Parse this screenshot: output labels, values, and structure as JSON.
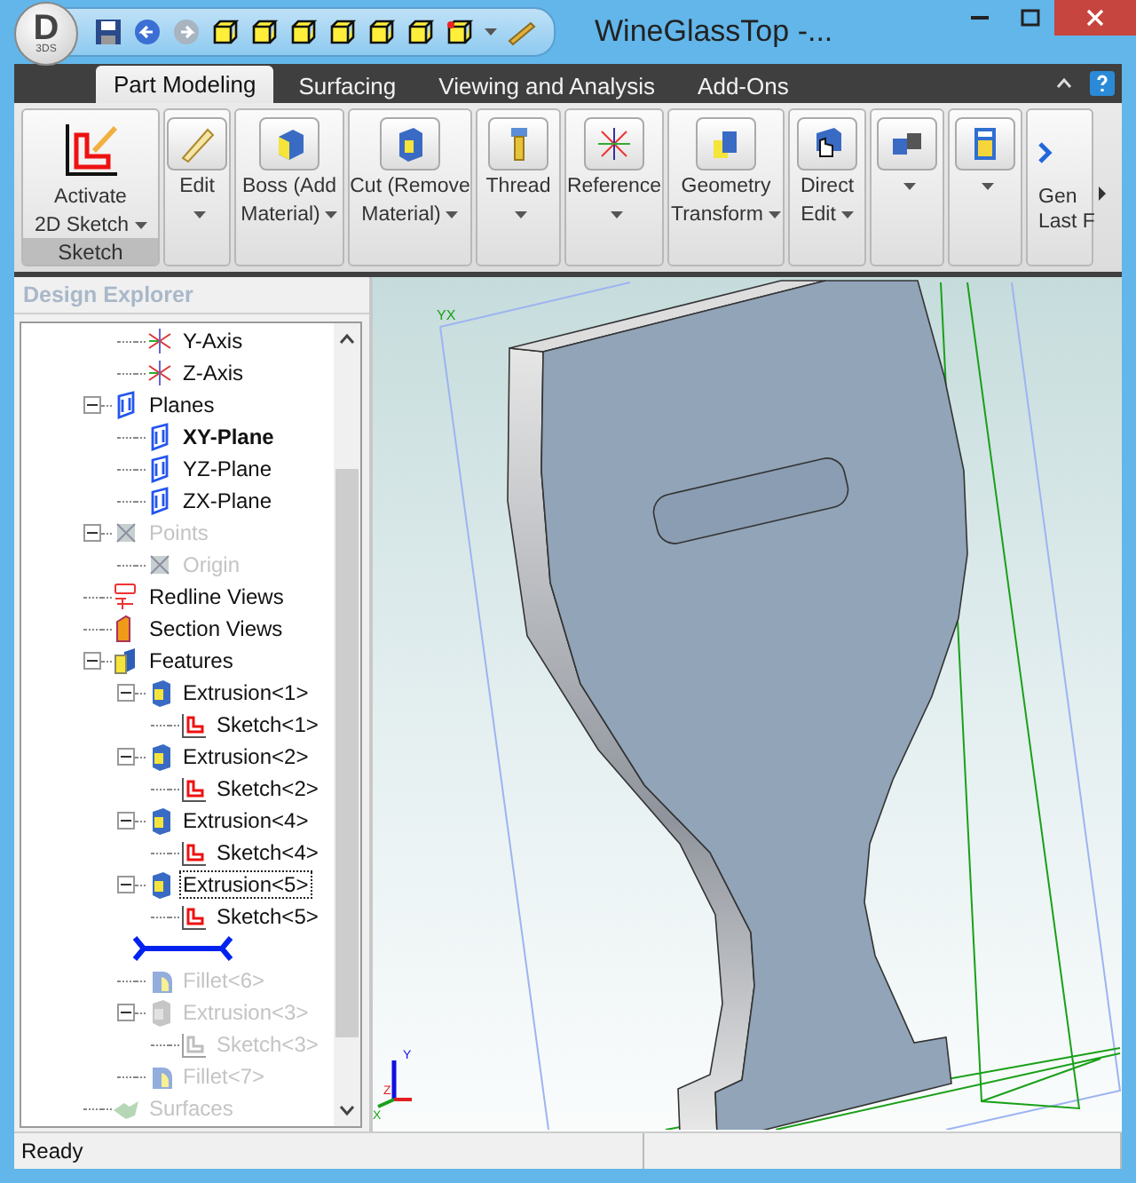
{
  "window": {
    "title": "WineGlassTop -...",
    "logo_letter": "D",
    "logo_sub": "3DS"
  },
  "quick_access": {
    "redo_disabled": true
  },
  "tabs": [
    {
      "label": "Part Modeling",
      "selected": true
    },
    {
      "label": "Surfacing",
      "selected": false
    },
    {
      "label": "Viewing and Analysis",
      "selected": false
    },
    {
      "label": "Add-Ons",
      "selected": false
    }
  ],
  "ribbon": {
    "buttons": [
      {
        "kind": "large",
        "lines": [
          "Activate",
          "2D Sketch"
        ],
        "dropdown": true,
        "group": "Sketch"
      },
      {
        "kind": "small",
        "lines": [
          "Edit"
        ],
        "dropdown": true
      },
      {
        "kind": "small",
        "lines": [
          "Boss (Add",
          "Material)"
        ],
        "dropdown": true
      },
      {
        "kind": "small",
        "lines": [
          "Cut (Remove",
          "Material)"
        ],
        "dropdown": true
      },
      {
        "kind": "small",
        "lines": [
          "Thread"
        ],
        "dropdown": true
      },
      {
        "kind": "small",
        "lines": [
          "Reference"
        ],
        "dropdown": true
      },
      {
        "kind": "small",
        "lines": [
          "Geometry",
          "Transform"
        ],
        "dropdown": true
      },
      {
        "kind": "small",
        "lines": [
          "Direct",
          "Edit"
        ],
        "dropdown": true
      },
      {
        "kind": "small",
        "dropdown": true
      },
      {
        "kind": "small",
        "dropdown": true
      },
      {
        "kind": "cut",
        "lines": [
          "Gen",
          "Last F"
        ],
        "dropdown": false
      }
    ]
  },
  "explorer": {
    "title": "Design Explorer",
    "tree": [
      {
        "children": [
          {
            "kind": "axis",
            "label": "Y-Axis",
            "active": false,
            "disabled": false,
            "selected": false
          },
          {
            "kind": "axis",
            "label": "Z-Axis",
            "active": false,
            "disabled": false,
            "selected": false
          }
        ]
      },
      {
        "kind": "plane",
        "label": "Planes",
        "active": false,
        "disabled": false,
        "selected": false,
        "children": [
          {
            "kind": "plane",
            "label": "XY-Plane",
            "active": true,
            "disabled": false,
            "selected": false
          },
          {
            "kind": "plane",
            "label": "YZ-Plane",
            "active": false,
            "disabled": false,
            "selected": false
          },
          {
            "kind": "plane",
            "label": "ZX-Plane",
            "active": false,
            "disabled": false,
            "selected": false
          }
        ]
      },
      {
        "kind": "point",
        "label": "Points",
        "active": false,
        "disabled": true,
        "selected": false,
        "children": [
          {
            "kind": "point",
            "label": "Origin",
            "active": false,
            "disabled": true,
            "selected": false
          }
        ]
      },
      {
        "kind": "redline",
        "label": "Redline Views",
        "active": false,
        "disabled": false,
        "selected": false
      },
      {
        "kind": "section",
        "label": "Section Views",
        "active": false,
        "disabled": false,
        "selected": false
      },
      {
        "kind": "features",
        "label": "Features",
        "active": false,
        "disabled": false,
        "selected": false,
        "children": [
          {
            "kind": "extrusion",
            "label": "Extrusion<1>",
            "active": false,
            "disabled": false,
            "selected": false,
            "children": [
              {
                "kind": "sketch",
                "label": "Sketch<1>",
                "active": false,
                "disabled": false,
                "selected": false
              }
            ]
          },
          {
            "kind": "extrusion",
            "label": "Extrusion<2>",
            "active": false,
            "disabled": false,
            "selected": false,
            "children": [
              {
                "kind": "sketch",
                "label": "Sketch<2>",
                "active": false,
                "disabled": false,
                "selected": false
              }
            ]
          },
          {
            "kind": "extrusion",
            "label": "Extrusion<4>",
            "active": false,
            "disabled": false,
            "selected": false,
            "children": [
              {
                "kind": "sketch",
                "label": "Sketch<4>",
                "active": false,
                "disabled": false,
                "selected": false
              }
            ]
          },
          {
            "kind": "extrusion",
            "label": "Extrusion<5>",
            "active": false,
            "disabled": false,
            "selected": true,
            "children": [
              {
                "kind": "sketch",
                "label": "Sketch<5>",
                "active": false,
                "disabled": false,
                "selected": false
              }
            ]
          },
          {
            "kind": "rollback"
          },
          {
            "kind": "fillet",
            "label": "Fillet<6>",
            "active": false,
            "disabled": true,
            "selected": false
          },
          {
            "kind": "extrusion",
            "label": "Extrusion<3>",
            "active": false,
            "disabled": true,
            "selected": false,
            "children": [
              {
                "kind": "sketch",
                "label": "Sketch<3>",
                "active": false,
                "disabled": true,
                "selected": false
              }
            ]
          },
          {
            "kind": "fillet",
            "label": "Fillet<7>",
            "active": false,
            "disabled": true,
            "selected": false
          }
        ]
      },
      {
        "kind": "surfaces",
        "label": "Surfaces",
        "active": false,
        "disabled": true,
        "selected": false
      }
    ]
  },
  "viewport": {
    "plane_label": "YX",
    "triad": {
      "y": "Y",
      "z": "Z",
      "x": "X"
    }
  },
  "status_bar": {
    "text": "Ready"
  }
}
